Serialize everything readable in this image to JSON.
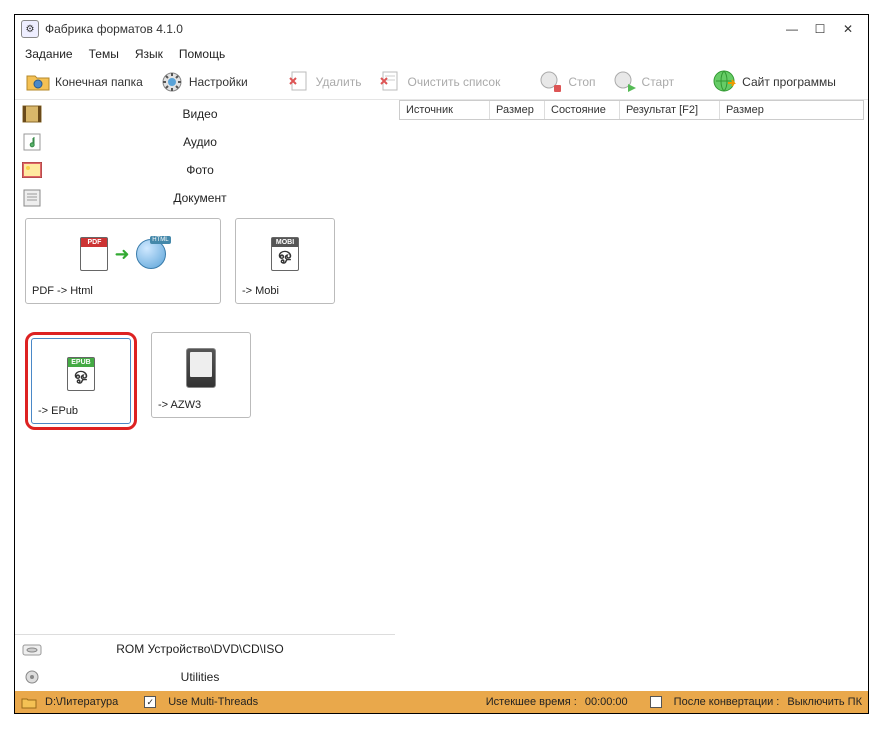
{
  "title": "Фабрика форматов 4.1.0",
  "window": {
    "min": "—",
    "max": "☐",
    "close": "✕"
  },
  "menu": [
    "Задание",
    "Темы",
    "Язык",
    "Помощь"
  ],
  "toolbar": {
    "output": "Конечная папка",
    "settings": "Настройки",
    "delete": "Удалить",
    "clear": "Очистить список",
    "stop": "Стоп",
    "start": "Старт",
    "site": "Сайт программы"
  },
  "categories": {
    "video": "Видео",
    "audio": "Аудио",
    "photo": "Фото",
    "document": "Документ"
  },
  "tiles": {
    "pdfhtml": "PDF -> Html",
    "mobi": "-> Mobi",
    "epub": "-> EPub",
    "azw3": "-> AZW3"
  },
  "bottomcats": {
    "rom": "ROM Устройство\\DVD\\CD\\ISO",
    "utilities": "Utilities"
  },
  "columns": {
    "source": "Источник",
    "size": "Размер",
    "state": "Состояние",
    "result": "Результат [F2]",
    "size2": "Размер"
  },
  "status": {
    "path": "D:\\Литература",
    "multithreads": "Use Multi-Threads",
    "elapsed_label": "Истекшее время :",
    "elapsed_value": "00:00:00",
    "after_label": "После конвертации :",
    "after_value": "Выключить ПК"
  },
  "badges": {
    "pdf": "PDF",
    "html": "HTML",
    "mobi": "MOBI",
    "epub": "EPUB"
  }
}
